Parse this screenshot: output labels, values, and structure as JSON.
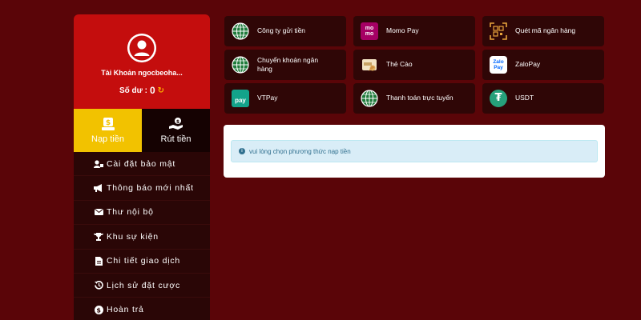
{
  "account": {
    "name": "Tài Khoản ngocbeoha...",
    "balance_label": "Số dư :",
    "balance_value": "0"
  },
  "tabs": [
    {
      "label": "Nạp tiền",
      "icon": "deposit-icon",
      "active": true
    },
    {
      "label": "Rút tiền",
      "icon": "withdraw-icon",
      "active": false
    }
  ],
  "menu": [
    {
      "label": "Cài đặt bảo mật",
      "icon": "user-lock-icon"
    },
    {
      "label": "Thông báo mới nhất",
      "icon": "megaphone-icon"
    },
    {
      "label": "Thư nội bộ",
      "icon": "envelope-icon"
    },
    {
      "label": "Khu sự kiện",
      "icon": "trophy-icon"
    },
    {
      "label": "Chi tiết giao dịch",
      "icon": "document-icon"
    },
    {
      "label": "Lịch sử đặt cược",
      "icon": "history-icon"
    },
    {
      "label": "Hoàn trả",
      "icon": "dollar-icon"
    }
  ],
  "methods": [
    {
      "label": "Công ty gửi tiền",
      "icon": "globe-icon"
    },
    {
      "label": "Momo Pay",
      "icon": "momo-icon",
      "icon_text": "mo mo"
    },
    {
      "label": "Quét mã ngân hàng",
      "icon": "qr-scan-icon"
    },
    {
      "label": "Chuyển khoản ngân hàng",
      "icon": "globe-icon"
    },
    {
      "label": "Thẻ Cào",
      "icon": "scratch-card-icon"
    },
    {
      "label": "ZaloPay",
      "icon": "zalopay-icon",
      "icon_text": "Zalo Pay"
    },
    {
      "label": "VTPay",
      "icon": "vtpay-icon",
      "icon_text": "pay"
    },
    {
      "label": "Thanh toán trực tuyến",
      "icon": "globe-icon"
    },
    {
      "label": "USDT",
      "icon": "tether-icon",
      "icon_text": "₮"
    }
  ],
  "notice": {
    "text": "vui lòng chọn phương thức nạp tiền"
  },
  "colors": {
    "background": "#5a0508",
    "account_header": "#c40d0d",
    "active_tab": "#f2c200",
    "sidebar": "#2a0606",
    "alert_bg": "#d9edf7",
    "alert_text": "#31708f"
  }
}
